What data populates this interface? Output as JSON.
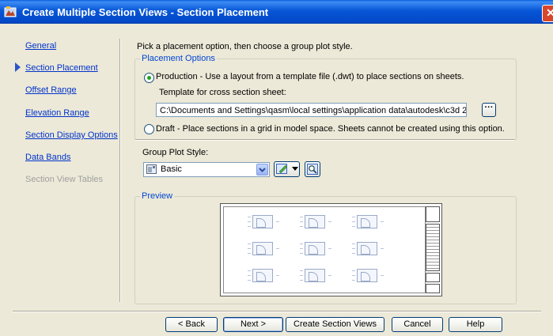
{
  "window": {
    "title": "Create Multiple Section Views - Section Placement",
    "close_symbol": "✕"
  },
  "nav": {
    "items": [
      {
        "label": "General",
        "enabled": true
      },
      {
        "label": "Section Placement",
        "enabled": true,
        "current": true
      },
      {
        "label": "Offset Range",
        "enabled": true
      },
      {
        "label": "Elevation Range",
        "enabled": true
      },
      {
        "label": "Section Display Options",
        "enabled": true
      },
      {
        "label": "Data Bands",
        "enabled": true
      },
      {
        "label": "Section View Tables",
        "enabled": false
      }
    ]
  },
  "main": {
    "instruction": "Pick a placement option, then choose a group plot style.",
    "placement_options": {
      "legend": "Placement Options",
      "production_label": "Production - Use a layout from a template file (.dwt) to place sections on sheets.",
      "production_selected": true,
      "template_label": "Template for cross section sheet:",
      "template_value": "C:\\Documents and Settings\\qasm\\local settings\\application data\\autodesk\\c3d 2",
      "browse_label": "···",
      "draft_label": "Draft - Place sections in a grid in model space. Sheets cannot be created using this option.",
      "draft_selected": false
    },
    "group_plot_style": {
      "label": "Group Plot Style:",
      "value": "Basic"
    },
    "preview": {
      "legend": "Preview"
    }
  },
  "buttons": {
    "back": "< Back",
    "next": "Next >",
    "create": "Create Section Views",
    "cancel": "Cancel",
    "help": "Help"
  },
  "colors": {
    "title_bar": "#0553d4",
    "link": "#0033cc",
    "legend": "#0046d5",
    "disabled": "#a0a0a0",
    "dialog_bg": "#ece9d8"
  }
}
